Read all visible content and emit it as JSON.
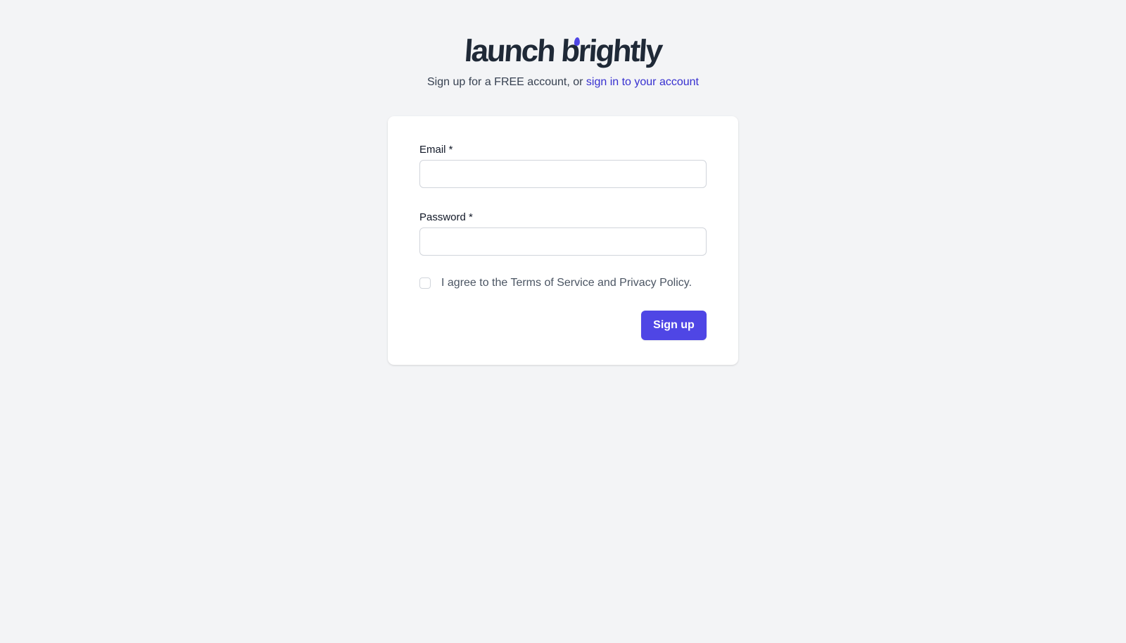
{
  "header": {
    "logo_word1": "launch",
    "logo_word2": "brightly",
    "tagline_prefix": "Sign up for a FREE account, or ",
    "signin_link": "sign in to your account"
  },
  "form": {
    "email_label": "Email *",
    "email_value": "",
    "password_label": "Password *",
    "password_value": "",
    "terms_checked": false,
    "terms_text": "I agree to the Terms of Service and Privacy Policy.",
    "submit_label": "Sign up"
  },
  "colors": {
    "background": "#f3f4f6",
    "accent": "#4f46e5",
    "link": "#3730d0",
    "logo_text": "#1f2937"
  },
  "icons": {
    "logo_mark": "flame-icon"
  }
}
